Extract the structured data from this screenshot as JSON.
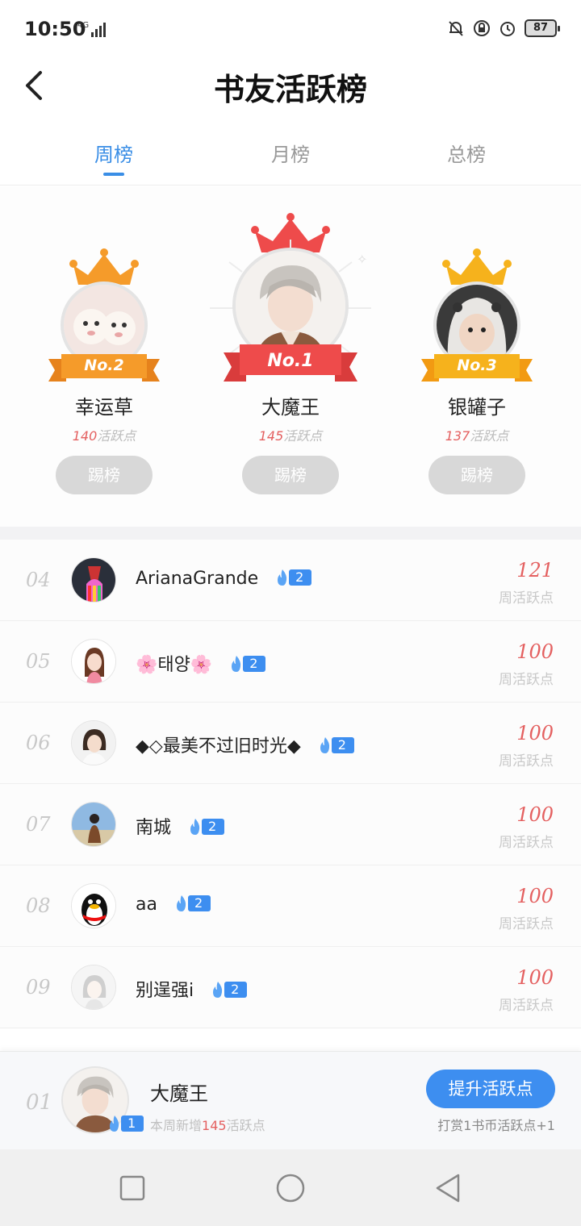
{
  "status_bar": {
    "time": "10:50",
    "network": "4G",
    "battery": "87"
  },
  "header": {
    "title": "书友活跃榜"
  },
  "tabs": [
    {
      "label": "周榜"
    },
    {
      "label": "月榜"
    },
    {
      "label": "总榜"
    }
  ],
  "podium": {
    "first": {
      "rank_label": "No.1",
      "name": "大魔王",
      "points": "145",
      "points_suffix": "活跃点",
      "kick_label": "踢榜"
    },
    "second": {
      "rank_label": "No.2",
      "name": "幸运草",
      "points": "140",
      "points_suffix": "活跃点",
      "kick_label": "踢榜"
    },
    "third": {
      "rank_label": "No.3",
      "name": "银罐子",
      "points": "137",
      "points_suffix": "活跃点",
      "kick_label": "踢榜"
    }
  },
  "list": [
    {
      "rank": "04",
      "name": "ArianaGrande",
      "level": "2",
      "score": "121",
      "score_label": "周活跃点"
    },
    {
      "rank": "05",
      "name": "🌸태양🌸",
      "level": "2",
      "score": "100",
      "score_label": "周活跃点"
    },
    {
      "rank": "06",
      "name": "◆◇最美不过旧时光◆",
      "level": "2",
      "score": "100",
      "score_label": "周活跃点"
    },
    {
      "rank": "07",
      "name": "南城",
      "level": "2",
      "score": "100",
      "score_label": "周活跃点"
    },
    {
      "rank": "08",
      "name": "aa",
      "level": "2",
      "score": "100",
      "score_label": "周活跃点"
    },
    {
      "rank": "09",
      "name": "别逞强i",
      "level": "2",
      "score": "100",
      "score_label": "周活跃点"
    }
  ],
  "my_rank": {
    "rank": "01",
    "name": "大魔王",
    "level": "1",
    "note_prefix": "本周新增",
    "note_points": "145",
    "note_suffix": "活跃点",
    "boost_label": "提升活跃点",
    "tip": "打赏1书币活跃点+1"
  },
  "colors": {
    "accent": "#3d8ef0",
    "score_red": "#e46060",
    "gold": "#f6b21c",
    "silver_orange": "#f59b2a",
    "first_red": "#ee4b4b"
  }
}
